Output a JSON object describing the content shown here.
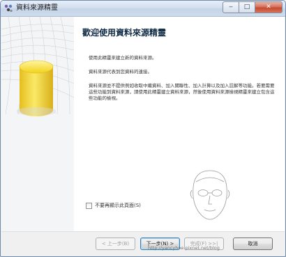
{
  "window": {
    "title": "資料來源精靈",
    "caption_buttons": {
      "minimize": "‒",
      "maximize": "□",
      "close": "✕"
    }
  },
  "main": {
    "heading": "歡迎使用資料來源精靈",
    "paragraph1": "使用此精靈來建立新的資料來源。",
    "paragraph2": "資料來源代表到您資料的連接。",
    "paragraph3": "資料來源並不提供例如收取中繼資料、加入關聯性、加入計算以及加入註解等功能。若要需要這些功能到資料來源，請使用此精靈建立資料來源，然後使用資料來源檢視精靈來建立包含這些功能的檢視。",
    "checkbox_label": "不要再顯示此頁面(S)",
    "checkbox_checked": false
  },
  "footer": {
    "back_label": "< 上一步(B)",
    "next_label": "下一步(N) >",
    "finish_label": "完成(F) >>|",
    "cancel_label": "取消"
  },
  "watermark": "http://yancyhoe.pixnet.net/blog",
  "colors": {
    "cylinder": "#f2d21a",
    "heading": "#0f2a44",
    "title_bar": "#d3e0ef"
  }
}
